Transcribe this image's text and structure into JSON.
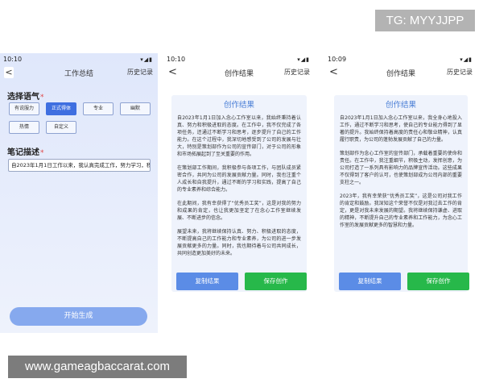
{
  "watermark_top": "TG: MYYJJPP",
  "watermark_bottom": "www.gameagbaccarat.com",
  "phone1": {
    "time": "10:10",
    "status_icons": "▾◢▮",
    "back": "<",
    "title": "工作总结",
    "history": "历史记录",
    "tone_label": "选择语气",
    "required": "*",
    "tones": [
      "有说服力",
      "正式得体",
      "专业",
      "幽默",
      "热情",
      "自定义"
    ],
    "active_tone_index": 1,
    "note_label": "笔记描述",
    "note_value": "自2023年1月1日工作以来，我认真完成工作，努力学习，积",
    "start_button": "开始生成"
  },
  "phone2": {
    "time": "10:10",
    "status_icons": "▾◢▮",
    "back": "<",
    "title": "创作结果",
    "history": "历史记录",
    "card_title": "创作结果",
    "paragraphs": [
      "自2023年1月1日加入念心工作室以来，我始终秉持着认真、努力和积极进取的态度。在工作中，我不仅完成了各项任务，还通过不断学习和思考，逐步提升了自己的工作能力。在这个过程中，我深切地感受到了公司的发展与壮大，特别是策划部作为公司的宣传部门，对于公司的形象和市场拓展起到了至关重要的作用。",
      "在策划部工作期间，我积极参与各项工作，与团队成员紧密合作，共同为公司的发展贡献力量。同时，我也注重个人成长和自我提升，通过不断的学习和实践，提高了自己的专业素养和综合能力。",
      "在此期间，我有幸获得了“优秀员工奖”，这是对我的努力和成果的肯定，也让我更加坚定了在念心工作室继续发展、不断进步的信念。",
      "展望未来，我将继续保持认真、努力、积极进取的态度，不断提高自己的工作能力和专业素养，为公司的进一步发展贡献更多的力量。同时，我也期待着与公司共同成长，共同创造更加美好的未来。"
    ],
    "copy_button": "复制结果",
    "save_button": "保存创作"
  },
  "phone3": {
    "time": "10:09",
    "status_icons": "▾◢▮",
    "back": "<",
    "title": "创作结果",
    "history": "历史记录",
    "card_title": "创作结果",
    "paragraphs": [
      "自2023年1月1日加入念心工作室以来，我全身心地投入工作，通过不断学习和思考，使自己的专业能力得到了显著的提升。我始终保持着高度的责任心和敬业精神，认真履行职责，为公司的蓬勃发展贡献了自己的力量。",
      "策划部作为念心工作室的宣传部门，承载着重要的使命和责任。在工作中，我注重细节，积极主动，发挥创意，为公司打造了一系列具有影响力的品牌宣传活动。这些成果不仅得到了客户的认可，也使策划部成为公司内部的重要支柱之一。",
      "2023年，我有幸荣获“优秀员工奖”，这是公司对我工作的肯定和鼓励。我深知这个荣誉不仅是对我过去工作的肯定，更是对我未来发展的期望。我将继续保持谦虚、进取的精神，不断提升自己的专业素养和工作能力，为念心工作室的发展贡献更多的智慧和力量。"
    ],
    "copy_button": "复制结果",
    "save_button": "保存创作"
  }
}
